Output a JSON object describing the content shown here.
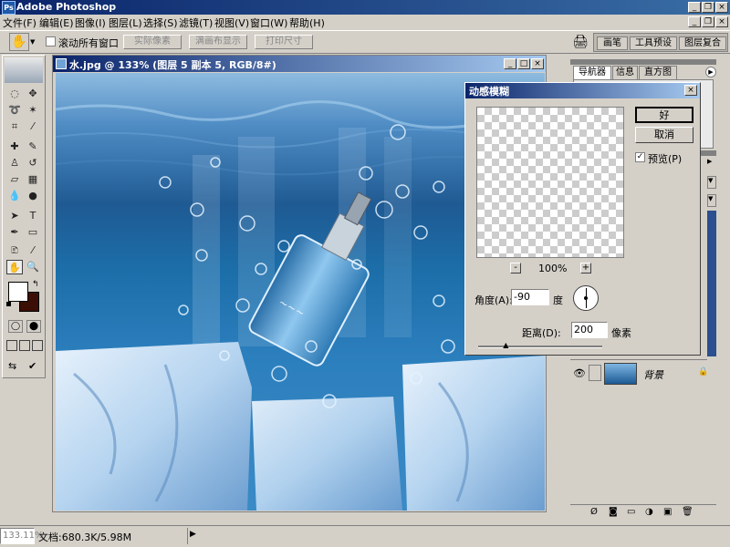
{
  "app": {
    "title": "Adobe Photoshop"
  },
  "menu": [
    "文件(F)",
    "编辑(E)",
    "图像(I)",
    "图层(L)",
    "选择(S)",
    "滤镜(T)",
    "视图(V)",
    "窗口(W)",
    "帮助(H)"
  ],
  "options": {
    "scroll_all_label": "滚动所有窗口",
    "actual_pixels": "实际像素",
    "fit_screen": "满画布显示",
    "print_size": "打印尺寸"
  },
  "palette_well_tabs": [
    "画笔",
    "工具预设",
    "图层复合"
  ],
  "document": {
    "title": "水.jpg @ 133% (图层 5 副本 5, RGB/8#)"
  },
  "dialog": {
    "title": "动感模糊",
    "ok": "好",
    "cancel": "取消",
    "preview_label": "预览(P)",
    "zoom_minus": "-",
    "zoom": "100%",
    "zoom_plus": "+",
    "angle_label": "角度(A):",
    "angle_value": "-90",
    "angle_unit": "度",
    "distance_label": "距离(D):",
    "distance_value": "200",
    "distance_unit": "像素",
    "distance_fraction": 0.23
  },
  "panels": {
    "navigator_tabs": [
      "导航器",
      "信息",
      "直方图"
    ],
    "layer_name": "背景"
  },
  "status": {
    "zoom": "133.11%",
    "doc_size": "文档:680.3K/5.98M"
  },
  "colors": {
    "title_blue": "#0a246a",
    "bg": "#d4d0c8",
    "foreground": "#ffffff",
    "background": "#3b0f05"
  }
}
